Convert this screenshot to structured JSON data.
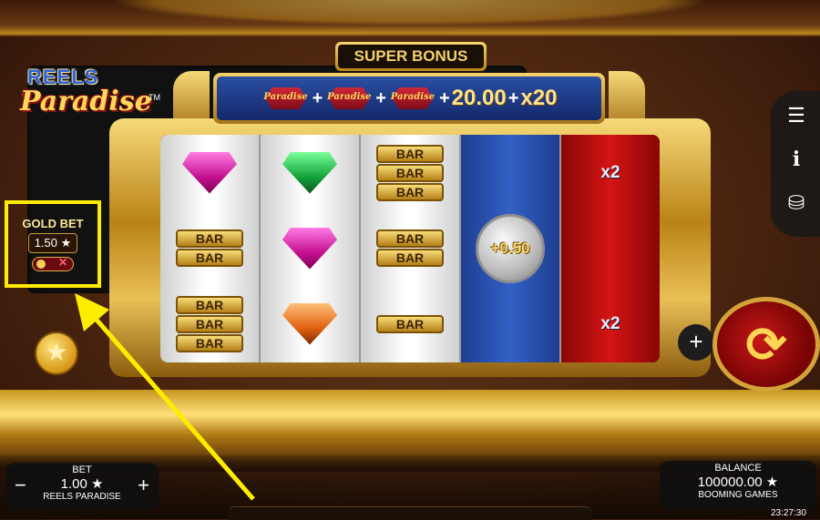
{
  "logo": {
    "top": "REELS",
    "bottom": "Paradise",
    "tm": "TM"
  },
  "super_bonus": {
    "label": "SUPER BONUS",
    "mini_logo_text": "Paradise",
    "plus": "+",
    "amount": "20.00",
    "multiplier": "x20"
  },
  "reels": {
    "bar_label": "BAR",
    "coin_value": "+0.50",
    "multiplier": "x2"
  },
  "gold_bet": {
    "title": "GOLD BET",
    "value": "1.50 ★",
    "toggle_off": "✕"
  },
  "side_menu": {
    "menu_icon": "☰",
    "info_icon": "i",
    "coins_icon": "⛁"
  },
  "controls": {
    "plus": "+",
    "spin": "⟳",
    "star": "★"
  },
  "bet": {
    "label": "BET",
    "value": "1.00 ★",
    "game": "REELS PARADISE",
    "minus": "−",
    "plus": "+"
  },
  "balance": {
    "label": "BALANCE",
    "value": "100000.00 ★",
    "brand": "BOOMING GAMES"
  },
  "clock": "23:27:30",
  "colors": {
    "highlight": "#ffed00",
    "gold": "#d6a52c",
    "reel_blue": "#2a56b8",
    "reel_red": "#c81010"
  }
}
